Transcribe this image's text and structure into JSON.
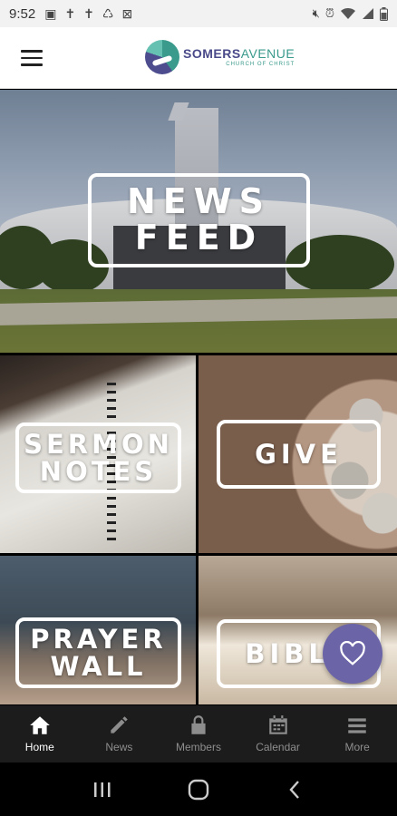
{
  "status_bar": {
    "time": "9:52",
    "notification_icons": [
      "calendar-icon",
      "cross-icon",
      "cross-icon",
      "recycle-icon",
      "blocked-icon"
    ],
    "system_icons": [
      "mute-icon",
      "alarm-icon",
      "wifi-icon",
      "signal-icon",
      "battery-icon"
    ]
  },
  "header": {
    "logo_name_bold": "SOMERS",
    "logo_name_thin": "AVENUE",
    "logo_subtitle": "CHURCH OF CHRIST"
  },
  "tiles": {
    "news_feed": {
      "line1": "NEWS",
      "line2": "FEED"
    },
    "sermon_notes": {
      "line1": "SERMON",
      "line2": "NOTES"
    },
    "give": {
      "line1": "GIVE"
    },
    "prayer_wall": {
      "line1": "PRAYER",
      "line2": "WALL"
    },
    "bible": {
      "line1": "BIBLE"
    }
  },
  "bottom_nav": {
    "items": [
      {
        "label": "Home",
        "icon": "home-icon",
        "active": true
      },
      {
        "label": "News",
        "icon": "pencil-icon",
        "active": false
      },
      {
        "label": "Members",
        "icon": "lock-icon",
        "active": false
      },
      {
        "label": "Calendar",
        "icon": "calendar-icon",
        "active": false
      },
      {
        "label": "More",
        "icon": "menu-icon",
        "active": false
      }
    ]
  },
  "colors": {
    "accent": "#6b65a8",
    "nav_bg": "#1c1c1c",
    "logo_teal": "#3a9a8c",
    "logo_purple": "#4a4a8a"
  }
}
